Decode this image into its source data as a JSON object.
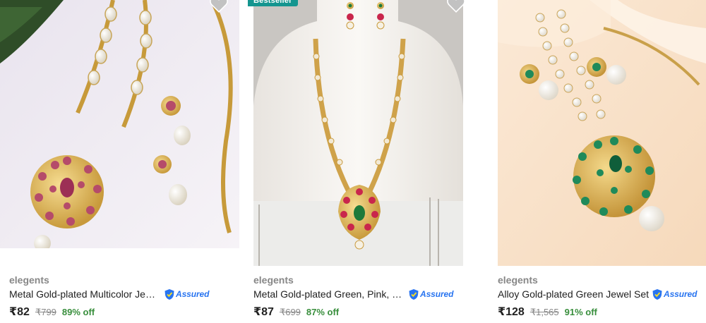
{
  "products": [
    {
      "brand": "elegents",
      "title": "Metal Gold-plated Multicolor Jewel Set",
      "assured_label": "Assured",
      "price": "₹82",
      "mrp": "₹799",
      "discount": "89% off"
    },
    {
      "badge": "Bestseller",
      "brand": "elegents",
      "title": "Metal Gold-plated Green, Pink, Gold Jewel Set",
      "assured_label": "Assured",
      "price": "₹87",
      "mrp": "₹699",
      "discount": "87% off"
    },
    {
      "brand": "elegents",
      "title": "Alloy Gold-plated Green Jewel Set",
      "assured_label": "Assured",
      "price": "₹128",
      "mrp": "₹1,565",
      "discount": "91% off"
    }
  ],
  "colors": {
    "accent": "#2874f0",
    "discount": "#388e3c",
    "badge": "#14958f",
    "muted": "#878787"
  },
  "icons": [
    "heart-icon",
    "assured-shield-icon"
  ]
}
